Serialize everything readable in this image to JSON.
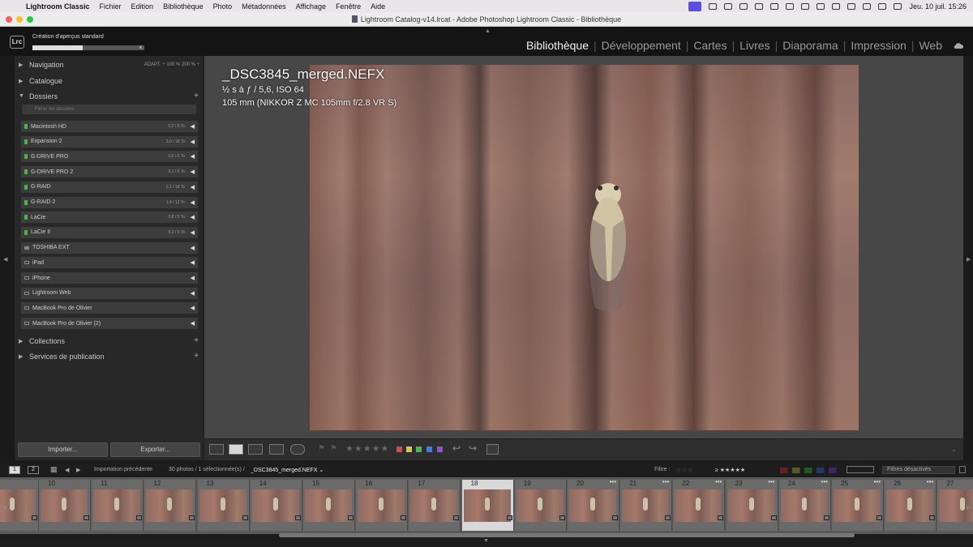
{
  "menubar": {
    "app_name": "Lightroom Classic",
    "items": [
      "Fichier",
      "Edition",
      "Bibliothèque",
      "Photo",
      "Métadonnées",
      "Affichage",
      "Fenêtre",
      "Aide"
    ],
    "clock": "Jeu. 10 juil.  15:26"
  },
  "window": {
    "title": "Lightroom Catalog-v14.lrcat - Adobe Photoshop Lightroom Classic - Bibliothèque"
  },
  "identity": {
    "logo": "Lrc",
    "task_label": "Création d'aperçus standard",
    "task_progress": 0.45,
    "task_close": "×"
  },
  "modules": [
    {
      "label": "Bibliothèque",
      "active": true
    },
    {
      "label": "Développement",
      "active": false
    },
    {
      "label": "Cartes",
      "active": false
    },
    {
      "label": "Livres",
      "active": false
    },
    {
      "label": "Diaporama",
      "active": false
    },
    {
      "label": "Impression",
      "active": false
    },
    {
      "label": "Web",
      "active": false
    }
  ],
  "left_panel": {
    "navigation": {
      "label": "Navigation",
      "zoom_options": "ADAPT. ÷   100 %   200 % ÷"
    },
    "catalogue": "Catalogue",
    "dossiers": "Dossiers",
    "search_placeholder": "Filtrer les dossiers",
    "volumes": [
      {
        "name": "Macintosh HD",
        "size": "0,2 / 8 To",
        "type": "disk"
      },
      {
        "name": "Expansion 2",
        "size": "3,0 / 18 To",
        "type": "disk"
      },
      {
        "name": "G-DRIVE PRO",
        "size": "0,0 / 6 To",
        "type": "disk"
      },
      {
        "name": "G-DRIVE PRO 2",
        "size": "0,1 / 6 To",
        "type": "disk"
      },
      {
        "name": "G-RAID",
        "size": "0,1 / 18 To",
        "type": "disk"
      },
      {
        "name": "G-RAID 2",
        "size": "1,4 / 12 To",
        "type": "disk"
      },
      {
        "name": "LaCie",
        "size": "0,8 / 5 To",
        "type": "disk"
      },
      {
        "name": "LaCie II",
        "size": "0,2 / 5 To",
        "type": "disk"
      },
      {
        "name": "TOSHIBA EXT",
        "size": "",
        "type": "offline"
      },
      {
        "name": "iPad",
        "size": "",
        "type": "device"
      },
      {
        "name": "iPhone",
        "size": "",
        "type": "device"
      },
      {
        "name": "Lightroom Web",
        "size": "",
        "type": "device"
      },
      {
        "name": "MacBook Pro de Olivier",
        "size": "",
        "type": "device"
      },
      {
        "name": "MacBook Pro de Olivier (2)",
        "size": "",
        "type": "device"
      }
    ],
    "collections": "Collections",
    "publish_services": "Services de publication",
    "import_button": "Importer...",
    "export_button": "Exporter..."
  },
  "viewer": {
    "filename": "_DSC3845_merged.NEFX",
    "exposure": "½ s à ƒ / 5,6, ISO 64",
    "lens": "105 mm (NIKKOR Z MC 105mm f/2.8 VR S)"
  },
  "toolbar": {
    "stars": "★★★★★",
    "color_labels": [
      "#d84a4a",
      "#d8c83a",
      "#4ab84a",
      "#4a7ad8",
      "#9a4ad8"
    ]
  },
  "filmstrip_bar": {
    "screen1": "1",
    "screen2": "2",
    "source": "Importation précédente",
    "selection_info": "30 photos / 1 sélectionnée(s) / ",
    "selected_file": "_DSC3845_merged.NEFX ⌄",
    "filter_label": "Filtre :",
    "rating_filter": "≥ ★★★★★",
    "filter_state": "Filtres désactivés"
  },
  "filmstrip": {
    "cells": [
      {
        "num": "",
        "dots": ""
      },
      {
        "num": "10",
        "dots": ""
      },
      {
        "num": "11",
        "dots": ""
      },
      {
        "num": "12",
        "dots": ""
      },
      {
        "num": "13",
        "dots": ""
      },
      {
        "num": "14",
        "dots": ""
      },
      {
        "num": "15",
        "dots": ""
      },
      {
        "num": "16",
        "dots": ""
      },
      {
        "num": "17",
        "dots": ""
      },
      {
        "num": "18",
        "dots": "",
        "selected": true
      },
      {
        "num": "19",
        "dots": ""
      },
      {
        "num": "20",
        "dots": "•••"
      },
      {
        "num": "21",
        "dots": "•••"
      },
      {
        "num": "22",
        "dots": "•••"
      },
      {
        "num": "23",
        "dots": "•••"
      },
      {
        "num": "24",
        "dots": "•••"
      },
      {
        "num": "25",
        "dots": "•••"
      },
      {
        "num": "26",
        "dots": "•••"
      },
      {
        "num": "27",
        "dots": "•••"
      }
    ]
  }
}
